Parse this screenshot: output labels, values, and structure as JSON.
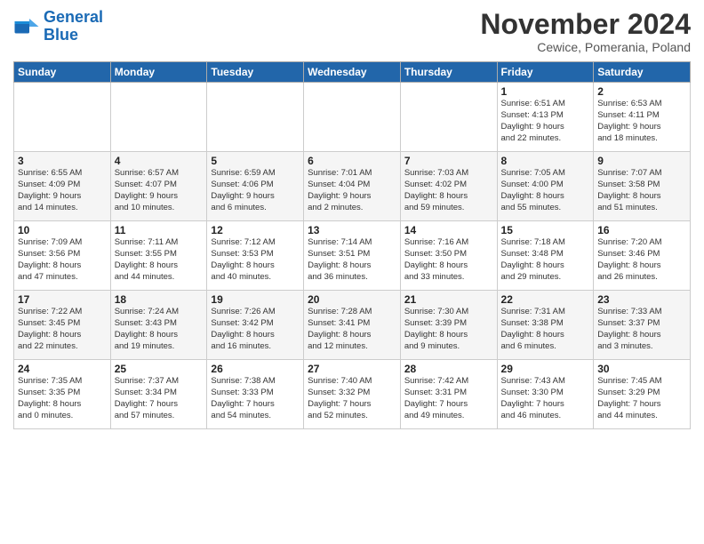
{
  "logo": {
    "line1": "General",
    "line2": "Blue"
  },
  "title": "November 2024",
  "subtitle": "Cewice, Pomerania, Poland",
  "headers": [
    "Sunday",
    "Monday",
    "Tuesday",
    "Wednesday",
    "Thursday",
    "Friday",
    "Saturday"
  ],
  "weeks": [
    [
      {
        "day": "",
        "info": ""
      },
      {
        "day": "",
        "info": ""
      },
      {
        "day": "",
        "info": ""
      },
      {
        "day": "",
        "info": ""
      },
      {
        "day": "",
        "info": ""
      },
      {
        "day": "1",
        "info": "Sunrise: 6:51 AM\nSunset: 4:13 PM\nDaylight: 9 hours\nand 22 minutes."
      },
      {
        "day": "2",
        "info": "Sunrise: 6:53 AM\nSunset: 4:11 PM\nDaylight: 9 hours\nand 18 minutes."
      }
    ],
    [
      {
        "day": "3",
        "info": "Sunrise: 6:55 AM\nSunset: 4:09 PM\nDaylight: 9 hours\nand 14 minutes."
      },
      {
        "day": "4",
        "info": "Sunrise: 6:57 AM\nSunset: 4:07 PM\nDaylight: 9 hours\nand 10 minutes."
      },
      {
        "day": "5",
        "info": "Sunrise: 6:59 AM\nSunset: 4:06 PM\nDaylight: 9 hours\nand 6 minutes."
      },
      {
        "day": "6",
        "info": "Sunrise: 7:01 AM\nSunset: 4:04 PM\nDaylight: 9 hours\nand 2 minutes."
      },
      {
        "day": "7",
        "info": "Sunrise: 7:03 AM\nSunset: 4:02 PM\nDaylight: 8 hours\nand 59 minutes."
      },
      {
        "day": "8",
        "info": "Sunrise: 7:05 AM\nSunset: 4:00 PM\nDaylight: 8 hours\nand 55 minutes."
      },
      {
        "day": "9",
        "info": "Sunrise: 7:07 AM\nSunset: 3:58 PM\nDaylight: 8 hours\nand 51 minutes."
      }
    ],
    [
      {
        "day": "10",
        "info": "Sunrise: 7:09 AM\nSunset: 3:56 PM\nDaylight: 8 hours\nand 47 minutes."
      },
      {
        "day": "11",
        "info": "Sunrise: 7:11 AM\nSunset: 3:55 PM\nDaylight: 8 hours\nand 44 minutes."
      },
      {
        "day": "12",
        "info": "Sunrise: 7:12 AM\nSunset: 3:53 PM\nDaylight: 8 hours\nand 40 minutes."
      },
      {
        "day": "13",
        "info": "Sunrise: 7:14 AM\nSunset: 3:51 PM\nDaylight: 8 hours\nand 36 minutes."
      },
      {
        "day": "14",
        "info": "Sunrise: 7:16 AM\nSunset: 3:50 PM\nDaylight: 8 hours\nand 33 minutes."
      },
      {
        "day": "15",
        "info": "Sunrise: 7:18 AM\nSunset: 3:48 PM\nDaylight: 8 hours\nand 29 minutes."
      },
      {
        "day": "16",
        "info": "Sunrise: 7:20 AM\nSunset: 3:46 PM\nDaylight: 8 hours\nand 26 minutes."
      }
    ],
    [
      {
        "day": "17",
        "info": "Sunrise: 7:22 AM\nSunset: 3:45 PM\nDaylight: 8 hours\nand 22 minutes."
      },
      {
        "day": "18",
        "info": "Sunrise: 7:24 AM\nSunset: 3:43 PM\nDaylight: 8 hours\nand 19 minutes."
      },
      {
        "day": "19",
        "info": "Sunrise: 7:26 AM\nSunset: 3:42 PM\nDaylight: 8 hours\nand 16 minutes."
      },
      {
        "day": "20",
        "info": "Sunrise: 7:28 AM\nSunset: 3:41 PM\nDaylight: 8 hours\nand 12 minutes."
      },
      {
        "day": "21",
        "info": "Sunrise: 7:30 AM\nSunset: 3:39 PM\nDaylight: 8 hours\nand 9 minutes."
      },
      {
        "day": "22",
        "info": "Sunrise: 7:31 AM\nSunset: 3:38 PM\nDaylight: 8 hours\nand 6 minutes."
      },
      {
        "day": "23",
        "info": "Sunrise: 7:33 AM\nSunset: 3:37 PM\nDaylight: 8 hours\nand 3 minutes."
      }
    ],
    [
      {
        "day": "24",
        "info": "Sunrise: 7:35 AM\nSunset: 3:35 PM\nDaylight: 8 hours\nand 0 minutes."
      },
      {
        "day": "25",
        "info": "Sunrise: 7:37 AM\nSunset: 3:34 PM\nDaylight: 7 hours\nand 57 minutes."
      },
      {
        "day": "26",
        "info": "Sunrise: 7:38 AM\nSunset: 3:33 PM\nDaylight: 7 hours\nand 54 minutes."
      },
      {
        "day": "27",
        "info": "Sunrise: 7:40 AM\nSunset: 3:32 PM\nDaylight: 7 hours\nand 52 minutes."
      },
      {
        "day": "28",
        "info": "Sunrise: 7:42 AM\nSunset: 3:31 PM\nDaylight: 7 hours\nand 49 minutes."
      },
      {
        "day": "29",
        "info": "Sunrise: 7:43 AM\nSunset: 3:30 PM\nDaylight: 7 hours\nand 46 minutes."
      },
      {
        "day": "30",
        "info": "Sunrise: 7:45 AM\nSunset: 3:29 PM\nDaylight: 7 hours\nand 44 minutes."
      }
    ]
  ]
}
